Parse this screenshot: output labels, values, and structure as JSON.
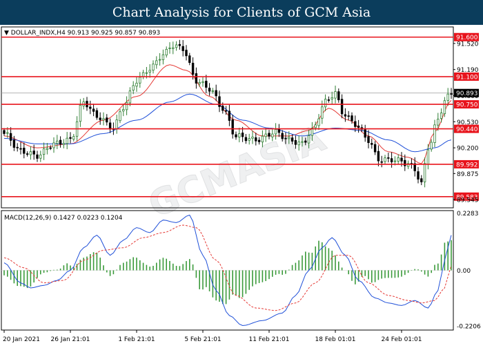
{
  "header": {
    "title": "Chart Analysis for Clients of GCM Asia"
  },
  "watermark": {
    "text": "GCMASIA"
  },
  "colors": {
    "header_bg": "#0b3d5c",
    "level_line": "#e8141c",
    "up_candle": "#2e7d32",
    "down_candle": "#000000",
    "ma_fast": "#e53935",
    "ma_slow": "#1e4fd8",
    "macd_line": "#1e4fd8",
    "signal_line": "#e53935",
    "hist": "#3a9a3a",
    "price_tag_bg": "#000000"
  },
  "chart_data": [
    {
      "type": "candlestick",
      "symbol_info": "DOLLAR_INDX,H4  90.913 90.925 90.857 90.893",
      "ylim": [
        89.45,
        91.72
      ],
      "y_ticks": [
        "91.520",
        "91.190",
        "90.860",
        "90.530",
        "90.200",
        "89.875",
        "89.545"
      ],
      "current_price": "90.893",
      "levels": [
        "91.600",
        "91.100",
        "90.750",
        "90.440",
        "89.992",
        "89.583"
      ],
      "x_ticks": [
        "20 Jan 2021",
        "26 Jan 21:01",
        "1 Feb 21:01",
        "5 Feb 21:01",
        "11 Feb 21:01",
        "18 Feb 01:01",
        "24 Feb 01:01"
      ],
      "x_tick_index": [
        0,
        20,
        40,
        60,
        80,
        100,
        120
      ],
      "n_bars": 136,
      "close_anchors": [
        [
          0,
          90.38
        ],
        [
          5,
          90.16
        ],
        [
          10,
          90.1
        ],
        [
          15,
          90.25
        ],
        [
          20,
          90.3
        ],
        [
          24,
          90.78
        ],
        [
          28,
          90.6
        ],
        [
          33,
          90.45
        ],
        [
          36,
          90.72
        ],
        [
          40,
          91.05
        ],
        [
          44,
          91.2
        ],
        [
          48,
          91.38
        ],
        [
          51,
          91.5
        ],
        [
          54,
          91.45
        ],
        [
          58,
          91.05
        ],
        [
          62,
          90.95
        ],
        [
          66,
          90.7
        ],
        [
          70,
          90.35
        ],
        [
          76,
          90.3
        ],
        [
          82,
          90.4
        ],
        [
          86,
          90.3
        ],
        [
          90,
          90.25
        ],
        [
          93,
          90.42
        ],
        [
          97,
          90.78
        ],
        [
          100,
          90.9
        ],
        [
          102,
          90.65
        ],
        [
          106,
          90.5
        ],
        [
          110,
          90.3
        ],
        [
          113,
          90.05
        ],
        [
          118,
          90.05
        ],
        [
          122,
          90.0
        ],
        [
          124,
          89.92
        ],
        [
          126,
          89.75
        ],
        [
          128,
          90.2
        ],
        [
          131,
          90.55
        ],
        [
          133,
          90.8
        ],
        [
          135,
          90.89
        ]
      ],
      "ma_fast_anchors": [
        [
          0,
          90.35
        ],
        [
          10,
          90.2
        ],
        [
          20,
          90.25
        ],
        [
          30,
          90.55
        ],
        [
          40,
          90.85
        ],
        [
          50,
          91.25
        ],
        [
          55,
          91.18
        ],
        [
          62,
          90.85
        ],
        [
          70,
          90.55
        ],
        [
          78,
          90.35
        ],
        [
          86,
          90.35
        ],
        [
          92,
          90.42
        ],
        [
          98,
          90.7
        ],
        [
          104,
          90.55
        ],
        [
          110,
          90.35
        ],
        [
          116,
          90.15
        ],
        [
          122,
          90.08
        ],
        [
          126,
          90.0
        ],
        [
          130,
          90.4
        ],
        [
          135,
          90.8
        ]
      ],
      "ma_slow_anchors": [
        [
          0,
          90.32
        ],
        [
          10,
          90.25
        ],
        [
          20,
          90.25
        ],
        [
          30,
          90.38
        ],
        [
          40,
          90.55
        ],
        [
          50,
          90.78
        ],
        [
          56,
          90.88
        ],
        [
          64,
          90.75
        ],
        [
          72,
          90.55
        ],
        [
          80,
          90.45
        ],
        [
          90,
          90.35
        ],
        [
          100,
          90.45
        ],
        [
          108,
          90.42
        ],
        [
          116,
          90.3
        ],
        [
          124,
          90.15
        ],
        [
          130,
          90.2
        ],
        [
          135,
          90.3
        ]
      ]
    },
    {
      "type": "line",
      "label": "MACD(12,26,9) 0.1427 0.0223 0.1204",
      "ylim": [
        -0.235,
        0.235
      ],
      "y_ticks": [
        "0.2283",
        "0.00",
        "-0.2206"
      ],
      "series": [
        {
          "name": "MACD",
          "points": [
            [
              0,
              0.03
            ],
            [
              5,
              -0.05
            ],
            [
              8,
              -0.07
            ],
            [
              12,
              -0.06
            ],
            [
              16,
              -0.04
            ],
            [
              20,
              0.0
            ],
            [
              24,
              0.09
            ],
            [
              28,
              0.14
            ],
            [
              32,
              0.06
            ],
            [
              36,
              0.12
            ],
            [
              40,
              0.17
            ],
            [
              44,
              0.15
            ],
            [
              48,
              0.2
            ],
            [
              52,
              0.19
            ],
            [
              56,
              0.22
            ],
            [
              60,
              0.06
            ],
            [
              64,
              -0.08
            ],
            [
              68,
              -0.18
            ],
            [
              72,
              -0.22
            ],
            [
              78,
              -0.2
            ],
            [
              84,
              -0.17
            ],
            [
              88,
              -0.1
            ],
            [
              92,
              0.0
            ],
            [
              96,
              0.09
            ],
            [
              99,
              0.13
            ],
            [
              103,
              0.06
            ],
            [
              107,
              -0.04
            ],
            [
              112,
              -0.11
            ],
            [
              116,
              -0.13
            ],
            [
              120,
              -0.14
            ],
            [
              124,
              -0.12
            ],
            [
              128,
              -0.15
            ],
            [
              131,
              -0.08
            ],
            [
              133,
              0.04
            ],
            [
              135,
              0.14
            ]
          ]
        },
        {
          "name": "Signal",
          "points": [
            [
              0,
              0.05
            ],
            [
              6,
              0.01
            ],
            [
              12,
              -0.05
            ],
            [
              18,
              -0.04
            ],
            [
              24,
              0.04
            ],
            [
              30,
              0.08
            ],
            [
              36,
              0.09
            ],
            [
              42,
              0.13
            ],
            [
              48,
              0.15
            ],
            [
              54,
              0.18
            ],
            [
              58,
              0.17
            ],
            [
              64,
              0.04
            ],
            [
              70,
              -0.1
            ],
            [
              76,
              -0.15
            ],
            [
              82,
              -0.16
            ],
            [
              88,
              -0.13
            ],
            [
              94,
              -0.05
            ],
            [
              100,
              0.06
            ],
            [
              104,
              0.06
            ],
            [
              110,
              -0.05
            ],
            [
              116,
              -0.1
            ],
            [
              122,
              -0.12
            ],
            [
              126,
              -0.13
            ],
            [
              130,
              -0.12
            ],
            [
              133,
              -0.07
            ],
            [
              135,
              0.02
            ]
          ]
        }
      ]
    }
  ]
}
